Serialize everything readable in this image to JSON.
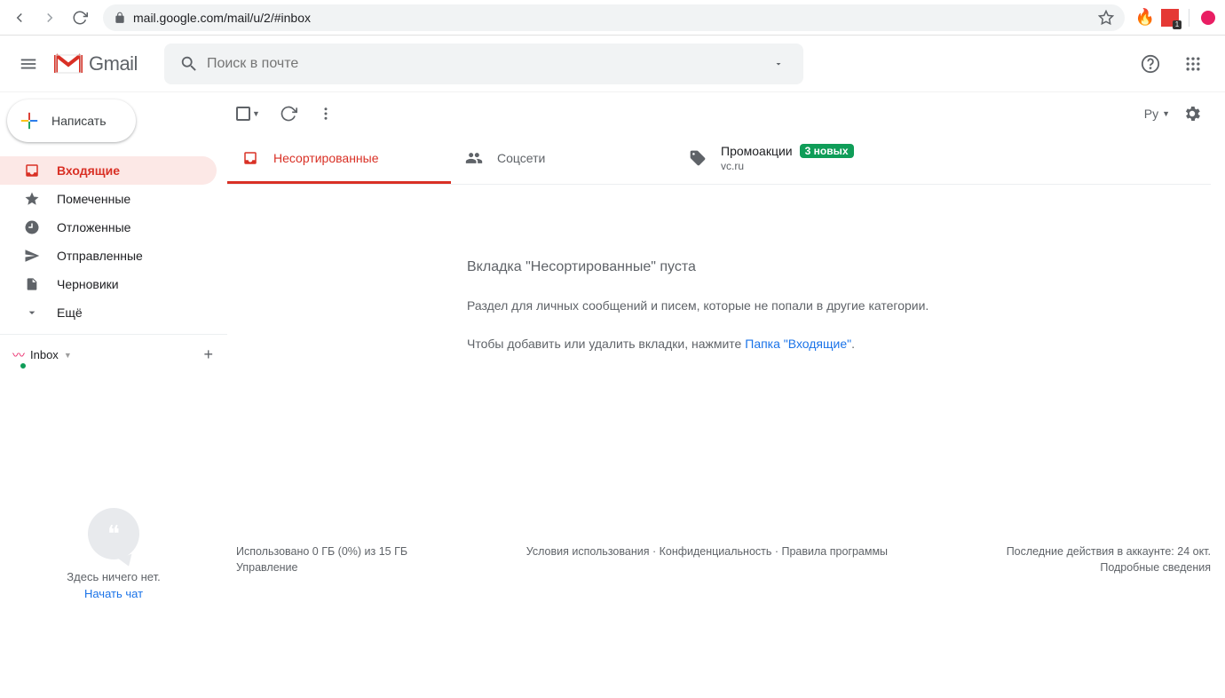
{
  "browser": {
    "url": "mail.google.com/mail/u/2/#inbox",
    "ext_badge": "1"
  },
  "header": {
    "logo_text": "Gmail",
    "search_placeholder": "Поиск в почте"
  },
  "compose": {
    "label": "Написать"
  },
  "sidebar": {
    "items": [
      {
        "label": "Входящие"
      },
      {
        "label": "Помеченные"
      },
      {
        "label": "Отложенные"
      },
      {
        "label": "Отправленные"
      },
      {
        "label": "Черновики"
      },
      {
        "label": "Ещё"
      }
    ]
  },
  "hangouts": {
    "user_label": "Inbox",
    "empty_text": "Здесь ничего нет.",
    "start_chat": "Начать чат"
  },
  "toolbar": {
    "lang": "Ру"
  },
  "tabs": {
    "primary": "Несортированные",
    "social": "Соцсети",
    "promotions": "Промоакции",
    "promotions_badge": "3 новых",
    "promotions_sub": "vc.ru"
  },
  "empty": {
    "title": "Вкладка \"Несортированные\" пуста",
    "desc": "Раздел для личных сообщений и писем, которые не попали в другие категории.",
    "action_prefix": "Чтобы добавить или удалить вкладки, нажмите ",
    "action_link": "Папка \"Входящие\"",
    "action_suffix": "."
  },
  "footer": {
    "storage_line": "Использовано 0 ГБ (0%) из 15 ГБ",
    "manage": "Управление",
    "terms": "Условия использования",
    "privacy": "Конфиденциальность",
    "policies": "Правила программы",
    "sep": " · ",
    "activity": "Последние действия в аккаунте: 24 окт.",
    "details": "Подробные сведения"
  }
}
